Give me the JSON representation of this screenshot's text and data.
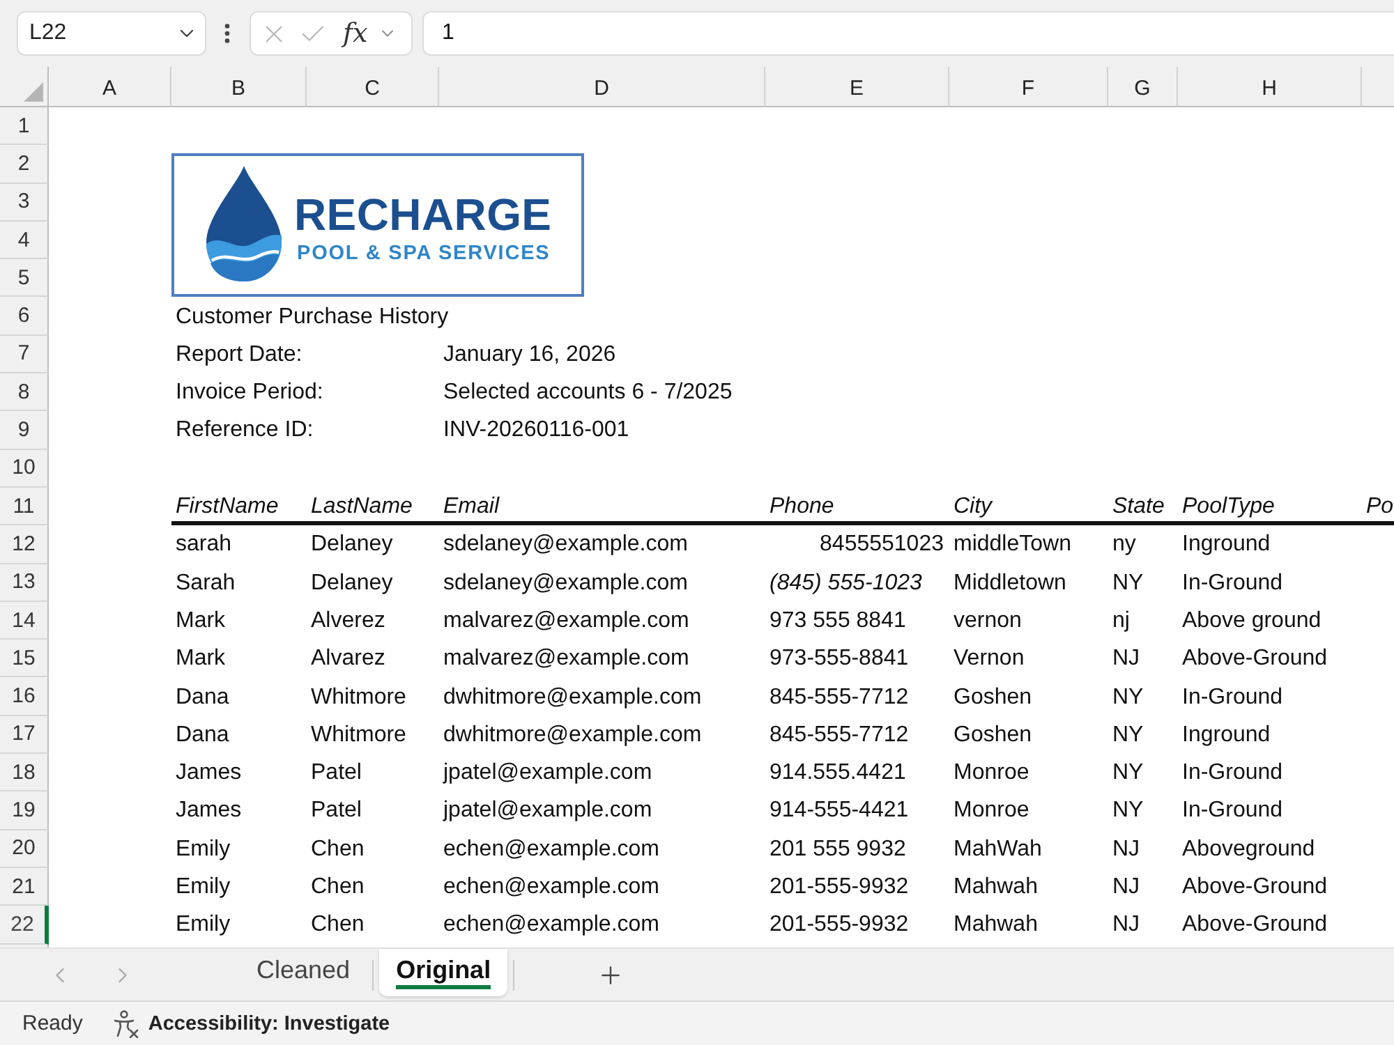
{
  "formula_bar": {
    "name_box": "L22",
    "buttons": [
      {
        "kind": "cancel",
        "disabled": true
      },
      {
        "kind": "enter",
        "disabled": true
      }
    ],
    "function_label": "fx",
    "formula": "1"
  },
  "column_headers": [
    "A",
    "B",
    "C",
    "D",
    "E",
    "F",
    "G",
    "H"
  ],
  "row_headers": [
    {
      "label": "1",
      "selected": false
    },
    {
      "label": "2",
      "selected": false
    },
    {
      "label": "3",
      "selected": false
    },
    {
      "label": "4",
      "selected": false
    },
    {
      "label": "5",
      "selected": false
    },
    {
      "label": "6",
      "selected": false
    },
    {
      "label": "7",
      "selected": false
    },
    {
      "label": "8",
      "selected": false
    },
    {
      "label": "9",
      "selected": false
    },
    {
      "label": "10",
      "selected": false
    },
    {
      "label": "11",
      "selected": false
    },
    {
      "label": "12",
      "selected": false
    },
    {
      "label": "13",
      "selected": false
    },
    {
      "label": "14",
      "selected": false
    },
    {
      "label": "15",
      "selected": false
    },
    {
      "label": "16",
      "selected": false
    },
    {
      "label": "17",
      "selected": false
    },
    {
      "label": "18",
      "selected": false
    },
    {
      "label": "19",
      "selected": false
    },
    {
      "label": "20",
      "selected": false
    },
    {
      "label": "21",
      "selected": false
    },
    {
      "label": "22",
      "selected": true
    }
  ],
  "logo": {
    "name": "RECHARGE",
    "tagline": "POOL & SPA SERVICES"
  },
  "report": {
    "title": "Customer Purchase History",
    "fields": [
      {
        "label": "Report Date:",
        "value": "January 16, 2026"
      },
      {
        "label": "Invoice Period:",
        "value": "Selected accounts 6 - 7/2025"
      },
      {
        "label": "Reference ID:",
        "value": "INV-20260116-001"
      }
    ]
  },
  "table": {
    "columns": [
      "FirstName",
      "LastName",
      "Email",
      "Phone",
      "City",
      "State",
      "PoolType",
      "Po"
    ],
    "rows": [
      [
        "sarah",
        "Delaney",
        "sdelaney@example.com",
        {
          "text": "8455551023",
          "kind": "number"
        },
        "middleTown",
        "ny",
        "Inground"
      ],
      [
        "Sarah",
        "Delaney",
        "sdelaney@example.com",
        {
          "text": "(845) 555-1023",
          "kind": "italic"
        },
        "Middletown",
        "NY",
        "In-Ground"
      ],
      [
        "Mark",
        "Alverez",
        "malvarez@example.com",
        "973 555 8841",
        "vernon",
        "nj",
        "Above ground"
      ],
      [
        "Mark",
        "Alvarez",
        "malvarez@example.com",
        "973-555-8841",
        "Vernon",
        "NJ",
        "Above-Ground"
      ],
      [
        "Dana",
        "Whitmore",
        "dwhitmore@example.com",
        "845-555-7712",
        "Goshen",
        "NY",
        "In-Ground"
      ],
      [
        "Dana",
        "Whitmore",
        "dwhitmore@example.com",
        "845-555-7712",
        "Goshen",
        "NY",
        "Inground"
      ],
      [
        "James",
        "Patel",
        "jpatel@example.com",
        "914.555.4421",
        "Monroe",
        "NY",
        "In-Ground"
      ],
      [
        "James",
        "Patel",
        "jpatel@example.com",
        "914-555-4421",
        "Monroe",
        "NY",
        "In-Ground"
      ],
      [
        "Emily",
        "Chen",
        "echen@example.com",
        "201 555 9932",
        "MahWah",
        "NJ",
        "Aboveground"
      ],
      [
        "Emily",
        "Chen",
        "echen@example.com",
        "201-555-9932",
        "Mahwah",
        "NJ",
        "Above-Ground"
      ],
      [
        "Emily",
        "Chen",
        "echen@example.com",
        "201-555-9932",
        "Mahwah",
        "NJ",
        "Above-Ground"
      ]
    ]
  },
  "sheet_tabs": {
    "nav": [
      {
        "kind": "previous",
        "disabled": true
      },
      {
        "kind": "next",
        "disabled": true
      }
    ],
    "tabs": [
      {
        "label": "Cleaned",
        "selected": false
      },
      {
        "label": "Original",
        "selected": true
      }
    ]
  },
  "status_bar": {
    "mode": "Ready",
    "accessibility": "Accessibility: Investigate"
  }
}
